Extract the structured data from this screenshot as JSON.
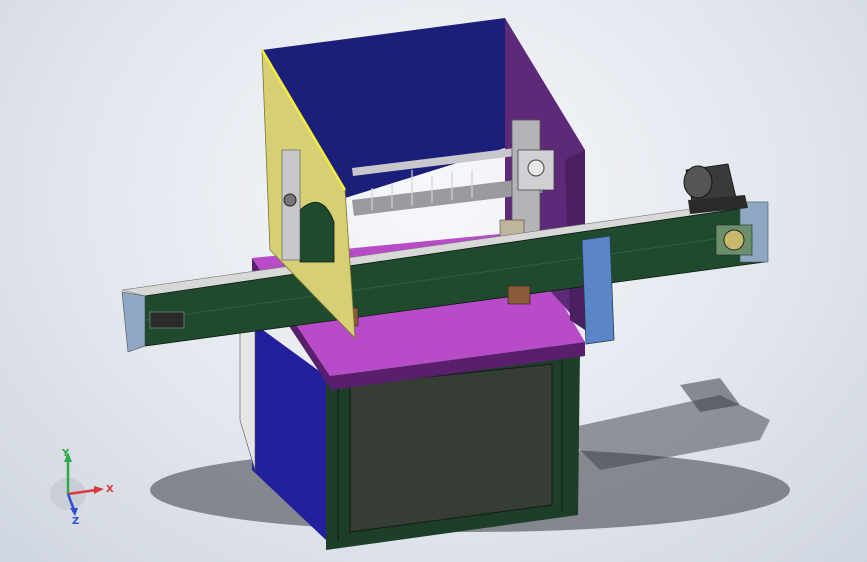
{
  "triad": {
    "x_label": "X",
    "y_label": "Y",
    "z_label": "Z"
  },
  "colors": {
    "background": "#dfe3ea",
    "cabinet_front": "#353d35",
    "cabinet_left": "#22209c",
    "cabinet_frame": "#1d3f2a",
    "platform": "#b84bc8",
    "platform_edge": "#5a1f6c",
    "hopper_back": "#1c1f7a",
    "hopper_right": "#5c2a78",
    "hopper_left": "#d6cf74",
    "conveyor": "#1f4a2e",
    "conveyor_top": "#d8d8d8",
    "motor": "#3a3a3a",
    "end_cap": "#8fa7c2",
    "blue_block": "#5a86c7",
    "axis_x": "#d93a3a",
    "axis_y": "#2fa84a",
    "axis_z": "#2a4fd1"
  },
  "icons": {
    "triad": "coordinate-axes-icon",
    "motor": "motor-icon"
  }
}
